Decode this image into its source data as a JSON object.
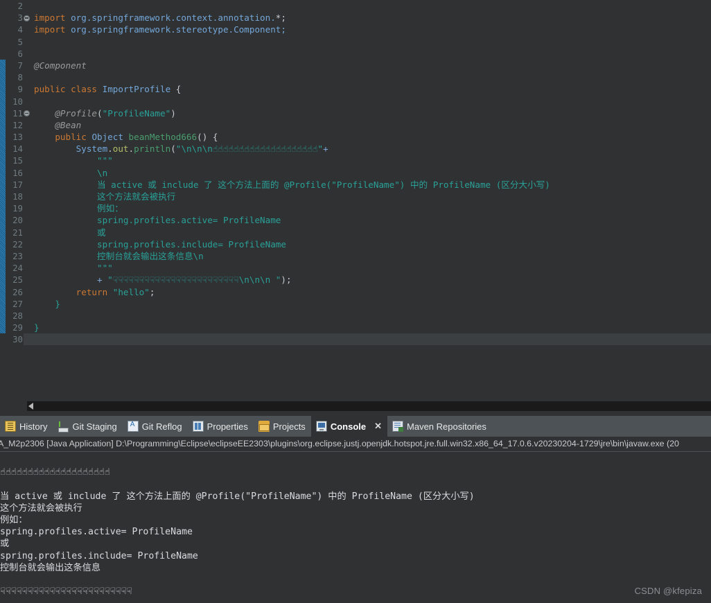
{
  "editor": {
    "first_visible_line": 2,
    "current_line": 30,
    "lines": [
      {
        "no": 2,
        "changed": false,
        "fold": false,
        "tokens": []
      },
      {
        "no": 3,
        "changed": false,
        "fold": true,
        "tokens": [
          {
            "t": "kw",
            "s": "import"
          },
          {
            "t": "plain",
            "s": " "
          },
          {
            "t": "typ",
            "s": "org.springframework.context.annotation."
          },
          {
            "t": "plain",
            "s": "*;"
          }
        ]
      },
      {
        "no": 4,
        "changed": false,
        "fold": false,
        "tokens": [
          {
            "t": "kw",
            "s": "import"
          },
          {
            "t": "plain",
            "s": " "
          },
          {
            "t": "typ",
            "s": "org.springframework.stereotype.Component;"
          }
        ]
      },
      {
        "no": 5,
        "changed": false,
        "fold": false,
        "tokens": []
      },
      {
        "no": 6,
        "changed": false,
        "fold": false,
        "tokens": []
      },
      {
        "no": 7,
        "changed": true,
        "fold": false,
        "tokens": [
          {
            "t": "anno",
            "s": "@Component"
          }
        ]
      },
      {
        "no": 8,
        "changed": true,
        "fold": false,
        "tokens": []
      },
      {
        "no": 9,
        "changed": true,
        "fold": false,
        "tokens": [
          {
            "t": "kw",
            "s": "public"
          },
          {
            "t": "plain",
            "s": " "
          },
          {
            "t": "kw",
            "s": "class"
          },
          {
            "t": "plain",
            "s": " "
          },
          {
            "t": "typ",
            "s": "ImportProfile"
          },
          {
            "t": "plain",
            "s": " {"
          }
        ]
      },
      {
        "no": 10,
        "changed": true,
        "fold": false,
        "tokens": []
      },
      {
        "no": 11,
        "changed": true,
        "fold": true,
        "tokens": [
          {
            "t": "plain",
            "s": "    "
          },
          {
            "t": "anno",
            "s": "@Profile"
          },
          {
            "t": "punc",
            "s": "("
          },
          {
            "t": "str",
            "s": "\"ProfileName\""
          },
          {
            "t": "punc",
            "s": ")"
          }
        ]
      },
      {
        "no": 12,
        "changed": true,
        "fold": false,
        "tokens": [
          {
            "t": "plain",
            "s": "    "
          },
          {
            "t": "anno",
            "s": "@Bean"
          }
        ]
      },
      {
        "no": 13,
        "changed": true,
        "fold": false,
        "tokens": [
          {
            "t": "plain",
            "s": "    "
          },
          {
            "t": "kw",
            "s": "public"
          },
          {
            "t": "plain",
            "s": " "
          },
          {
            "t": "typ",
            "s": "Object"
          },
          {
            "t": "plain",
            "s": " "
          },
          {
            "t": "mth",
            "s": "beanMethod666"
          },
          {
            "t": "punc",
            "s": "() {"
          }
        ]
      },
      {
        "no": 14,
        "changed": true,
        "fold": false,
        "tokens": [
          {
            "t": "plain",
            "s": "        "
          },
          {
            "t": "typ",
            "s": "System"
          },
          {
            "t": "punc",
            "s": "."
          },
          {
            "t": "fld",
            "s": "out"
          },
          {
            "t": "punc",
            "s": "."
          },
          {
            "t": "mth",
            "s": "println"
          },
          {
            "t": "punc",
            "s": "("
          },
          {
            "t": "str",
            "s": "\"\\n\\n\\n☝☝☝☝☝☝☝☝☝☝☝☝☝☝☝☝☝☝☝☝\""
          },
          {
            "t": "op",
            "s": "+"
          }
        ]
      },
      {
        "no": 15,
        "changed": true,
        "fold": false,
        "tokens": [
          {
            "t": "plain",
            "s": "            "
          },
          {
            "t": "str",
            "s": "\"\"\""
          }
        ]
      },
      {
        "no": 16,
        "changed": true,
        "fold": false,
        "tokens": [
          {
            "t": "plain",
            "s": "            "
          },
          {
            "t": "str",
            "s": "\\n"
          }
        ]
      },
      {
        "no": 17,
        "changed": true,
        "fold": false,
        "tokens": [
          {
            "t": "plain",
            "s": "            "
          },
          {
            "t": "cn",
            "s": "当 active 或 include 了 这个方法上面的 @Profile(\"ProfileName\") 中的 ProfileName (区分大小写)"
          }
        ]
      },
      {
        "no": 18,
        "changed": true,
        "fold": false,
        "tokens": [
          {
            "t": "plain",
            "s": "            "
          },
          {
            "t": "cn",
            "s": "这个方法就会被执行"
          }
        ]
      },
      {
        "no": 19,
        "changed": true,
        "fold": false,
        "tokens": [
          {
            "t": "plain",
            "s": "            "
          },
          {
            "t": "cn",
            "s": "例如："
          }
        ]
      },
      {
        "no": 20,
        "changed": true,
        "fold": false,
        "tokens": [
          {
            "t": "plain",
            "s": "            "
          },
          {
            "t": "str",
            "s": "spring.profiles.active= ProfileName"
          }
        ]
      },
      {
        "no": 21,
        "changed": true,
        "fold": false,
        "tokens": [
          {
            "t": "plain",
            "s": "            "
          },
          {
            "t": "cn",
            "s": "或"
          }
        ]
      },
      {
        "no": 22,
        "changed": true,
        "fold": false,
        "tokens": [
          {
            "t": "plain",
            "s": "            "
          },
          {
            "t": "str",
            "s": "spring.profiles.include= ProfileName"
          }
        ]
      },
      {
        "no": 23,
        "changed": true,
        "fold": false,
        "tokens": [
          {
            "t": "plain",
            "s": "            "
          },
          {
            "t": "cn",
            "s": "控制台就会输出这条信息\\n"
          }
        ]
      },
      {
        "no": 24,
        "changed": true,
        "fold": false,
        "tokens": [
          {
            "t": "plain",
            "s": "            "
          },
          {
            "t": "str",
            "s": "\"\"\""
          }
        ]
      },
      {
        "no": 25,
        "changed": true,
        "fold": false,
        "tokens": [
          {
            "t": "plain",
            "s": "            "
          },
          {
            "t": "op",
            "s": "+ "
          },
          {
            "t": "str",
            "s": "\"☟☟☟☟☟☟☟☟☟☟☟☟☟☟☟☟☟☟☟☟☟☟☟☟\\n\\n\\n \""
          },
          {
            "t": "punc",
            "s": ");"
          }
        ]
      },
      {
        "no": 26,
        "changed": true,
        "fold": false,
        "tokens": [
          {
            "t": "plain",
            "s": "        "
          },
          {
            "t": "kw",
            "s": "return"
          },
          {
            "t": "plain",
            "s": " "
          },
          {
            "t": "str",
            "s": "\"hello\""
          },
          {
            "t": "punc",
            "s": ";"
          }
        ]
      },
      {
        "no": 27,
        "changed": true,
        "fold": false,
        "tokens": [
          {
            "t": "plain",
            "s": "    "
          },
          {
            "t": "str",
            "s": "}"
          }
        ]
      },
      {
        "no": 28,
        "changed": true,
        "fold": false,
        "tokens": []
      },
      {
        "no": 29,
        "changed": true,
        "fold": false,
        "tokens": [
          {
            "t": "str",
            "s": "}"
          }
        ]
      },
      {
        "no": 30,
        "changed": false,
        "fold": false,
        "tokens": []
      }
    ]
  },
  "hscroll": {
    "arrow_icon": "scroll-left-arrow"
  },
  "tabbar": {
    "tabs": [
      {
        "label": "History",
        "icon": "history-icon",
        "icon_class": "ic-history",
        "active": false,
        "closable": false
      },
      {
        "label": "Git Staging",
        "icon": "git-staging-icon",
        "icon_class": "ic-gitstaging",
        "active": false,
        "closable": false
      },
      {
        "label": "Git Reflog",
        "icon": "git-reflog-icon",
        "icon_class": "ic-gitreflog",
        "active": false,
        "closable": false
      },
      {
        "label": "Properties",
        "icon": "properties-icon",
        "icon_class": "ic-properties",
        "active": false,
        "closable": false
      },
      {
        "label": "Projects",
        "icon": "projects-icon",
        "icon_class": "ic-projects",
        "active": false,
        "closable": false
      },
      {
        "label": "Console",
        "icon": "console-icon",
        "icon_class": "ic-console",
        "active": true,
        "closable": true,
        "close_label": "✕"
      },
      {
        "label": "Maven Repositories",
        "icon": "maven-icon",
        "icon_class": "ic-maven",
        "active": false,
        "closable": false
      }
    ]
  },
  "console": {
    "launch_line": "A_M2p2306 [Java Application] D:\\Programming\\Eclipse\\eclipseEE2303\\plugins\\org.eclipse.justj.openjdk.hotspot.jre.full.win32.x86_64_17.0.6.v20230204-1729\\jre\\bin\\javaw.exe  (20",
    "output_lines": [
      "",
      "☝☝☝☝☝☝☝☝☝☝☝☝☝☝☝☝☝☝☝☝",
      "",
      "当 active 或 include 了 这个方法上面的 @Profile(\"ProfileName\") 中的 ProfileName (区分大小写)",
      "这个方法就会被执行",
      "例如：",
      "spring.profiles.active= ProfileName",
      "或",
      "spring.profiles.include= ProfileName",
      "控制台就会输出这条信息",
      "",
      "☟☟☟☟☟☟☟☟☟☟☟☟☟☟☟☟☟☟☟☟☟☟☟☟"
    ]
  },
  "watermark": {
    "text": "CSDN @kfepiza"
  },
  "colors": {
    "editor_bg": "#2f3133",
    "current_line_bg": "#3c3f41",
    "tabbar_bg": "#4d5256",
    "change_bar": "#2b7fb8",
    "keyword": "#cc7832",
    "type": "#74a7d9",
    "method": "#4a9e6e",
    "string": "#2aa198",
    "annotation": "#9a9a9a",
    "field": "#b5bd68",
    "console_text": "#d9dcde",
    "linenumber": "#6f7b80"
  }
}
